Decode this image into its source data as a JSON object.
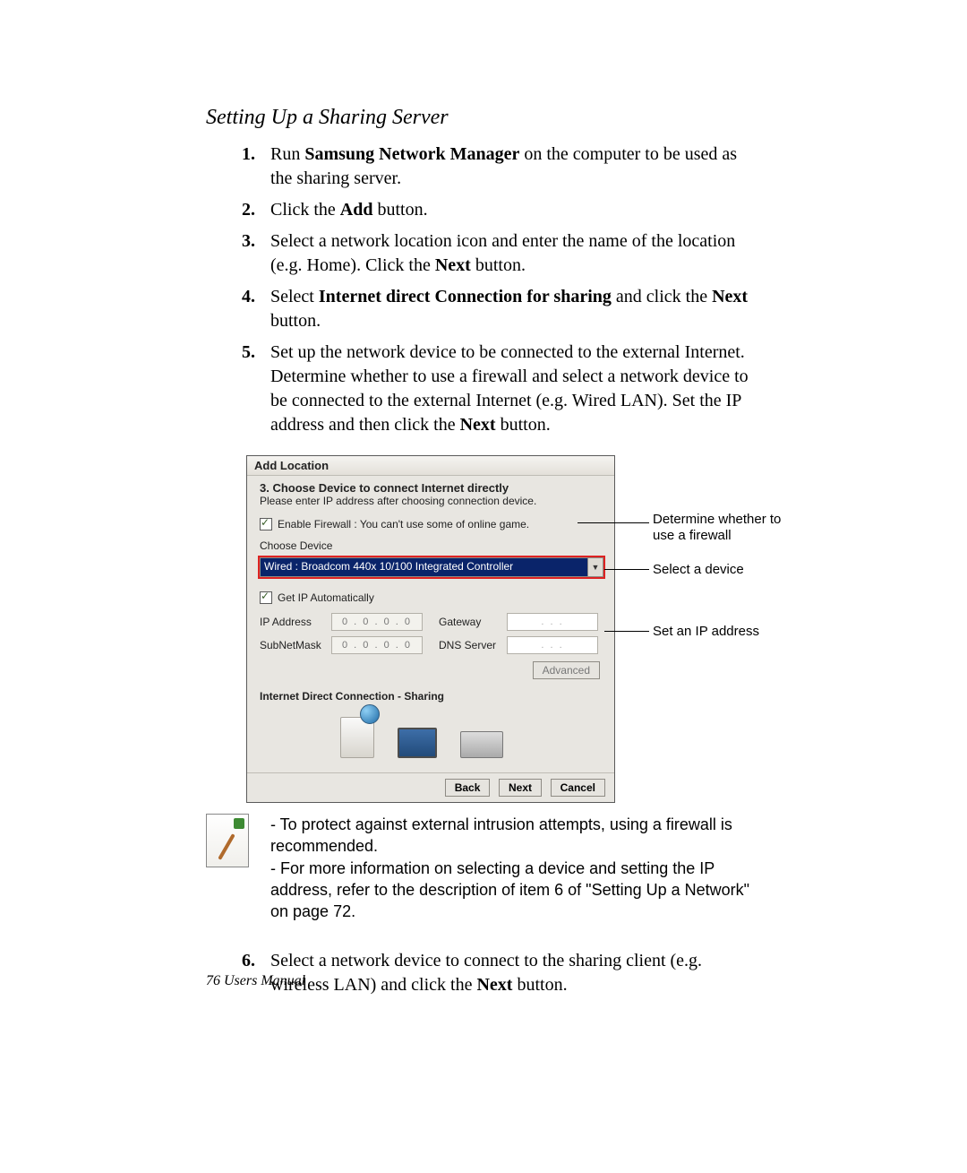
{
  "title": "Setting Up a Sharing Server",
  "steps": {
    "s1": {
      "num": "1.",
      "t1": "Run ",
      "b1": "Samsung Network Manager",
      "t2": " on the computer to be used as the sharing server."
    },
    "s2": {
      "num": "2.",
      "t1": "Click the ",
      "b1": "Add",
      "t2": " button."
    },
    "s3": {
      "num": "3.",
      "t1": "Select a network location icon and enter the name of the location (e.g. Home). Click the ",
      "b1": "Next",
      "t2": " button."
    },
    "s4": {
      "num": "4.",
      "t1": "Select ",
      "b1": "Internet direct Connection for sharing",
      "t2": " and click the ",
      "b2": "Next",
      "t3": " button."
    },
    "s5": {
      "num": "5.",
      "t1": "Set up the network device to be connected to the external Internet. Determine whether to use a firewall and select a network device to be connected to the external Internet (e.g. Wired LAN). Set the IP address and then click the ",
      "b1": "Next",
      "t2": " button."
    },
    "s6": {
      "num": "6.",
      "t1": "Select a network device to connect to the sharing client (e.g. wireless LAN) and click the ",
      "b1": "Next",
      "t2": " button."
    }
  },
  "dialog": {
    "title": "Add Location",
    "heading": "3. Choose Device to connect Internet directly",
    "subheading": "Please enter IP address after choosing connection device.",
    "firewall_label": "Enable Firewall : You can't use some of online game.",
    "choose_device_label": "Choose Device",
    "device_value": "Wired : Broadcom 440x 10/100 Integrated Controller",
    "get_ip_label": "Get IP Automatically",
    "ip_address_label": "IP Address",
    "subnet_label": "SubNetMask",
    "gateway_label": "Gateway",
    "dns_label": "DNS Server",
    "ip_placeholder": "0 . 0 . 0 . 0",
    "blank_placeholder": ".   .   .",
    "advanced": "Advanced",
    "sharing_title": "Internet Direct Connection - Sharing",
    "back": "Back",
    "next": "Next",
    "cancel": "Cancel"
  },
  "annotations": {
    "firewall": "Determine whether to use a firewall",
    "device": "Select a device",
    "ip": "Set an IP address"
  },
  "notes": {
    "n1": "- To protect against external intrusion attempts, using a firewall is recommended.",
    "n2": "- For more information on selecting a device and setting the IP address, refer to the description of item 6 of  \"Setting Up a Network\" on page 72."
  },
  "footer": {
    "page": "76",
    "label": "  Users Manual"
  }
}
